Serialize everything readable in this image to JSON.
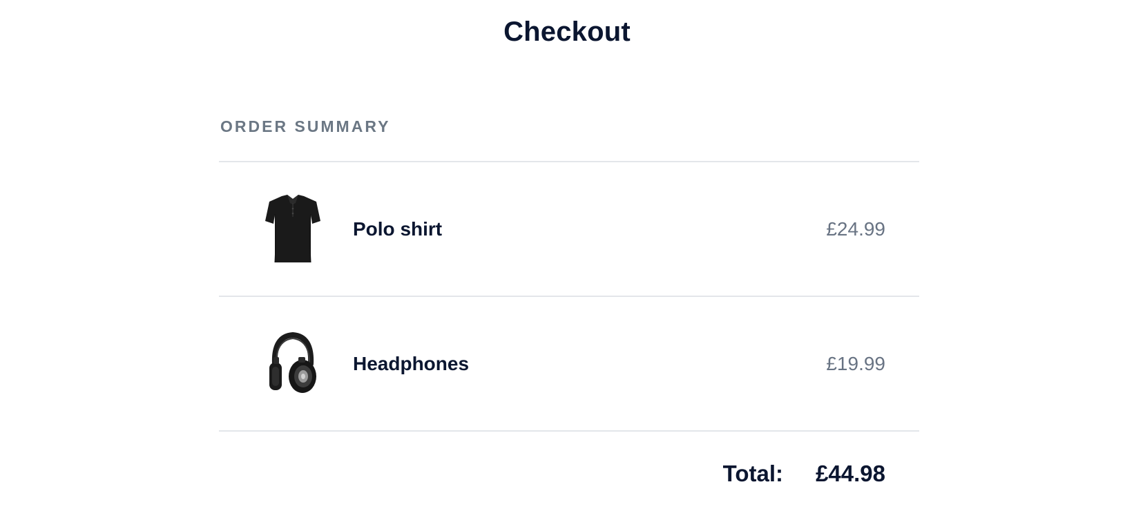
{
  "page": {
    "title": "Checkout"
  },
  "order_summary": {
    "heading": "ORDER SUMMARY",
    "items": [
      {
        "name": "Polo shirt",
        "price": "£24.99",
        "image_icon": "polo-shirt-image"
      },
      {
        "name": "Headphones",
        "price": "£19.99",
        "image_icon": "headphones-image"
      }
    ],
    "total_label": "Total:",
    "total_value": "£44.98"
  },
  "colors": {
    "text_primary": "#0b1630",
    "text_muted": "#687383",
    "heading_muted": "#6b7784",
    "divider": "#e3e6ea",
    "background": "#ffffff"
  }
}
